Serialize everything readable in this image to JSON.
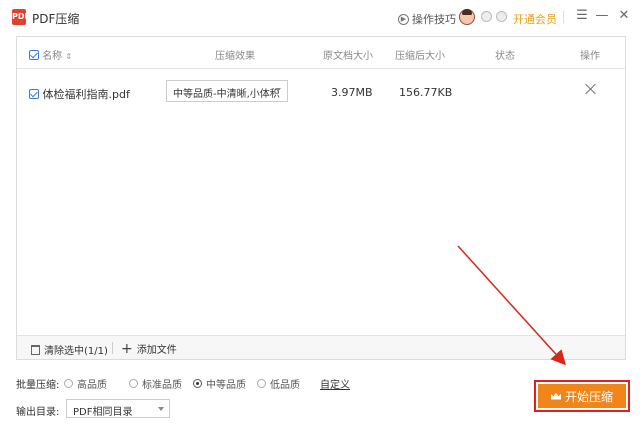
{
  "app": {
    "title": "PDF压缩",
    "logo_text": "PDF"
  },
  "titlebar": {
    "tips_label": "操作技巧",
    "vip_label": "开通会员"
  },
  "table": {
    "headers": {
      "name": "名称",
      "effect": "压缩效果",
      "orig_size": "原文档大小",
      "new_size": "压缩后大小",
      "status": "状态",
      "action": "操作"
    },
    "rows": [
      {
        "name": "体检福利指南.pdf",
        "effect": "中等品质-中清晰,小体积",
        "orig_size": "3.97MB",
        "new_size": "156.77KB",
        "status": ""
      }
    ],
    "footer": {
      "clear_label": "清除选中(1/1)",
      "add_label": "添加文件"
    }
  },
  "settings": {
    "batch_label": "批量压缩:",
    "options": [
      "高品质",
      "标准品质",
      "中等品质",
      "低品质"
    ],
    "selected": "中等品质",
    "custom_label": "自定义",
    "output_label": "输出目录:",
    "output_value": "PDF相同目录"
  },
  "start_button": {
    "label": "开始压缩"
  },
  "colors": {
    "accent": "#f0861a",
    "highlight_border": "#e0201c",
    "checkbox": "#3b7bd8",
    "vip": "#e6a01c"
  }
}
